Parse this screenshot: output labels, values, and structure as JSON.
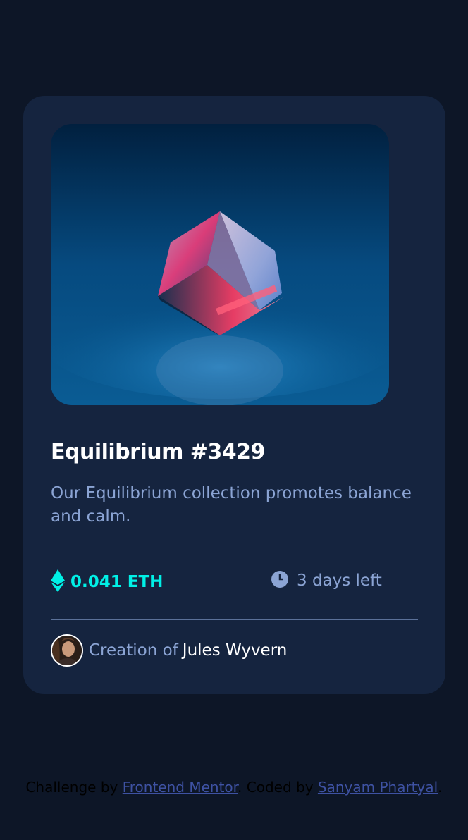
{
  "card": {
    "image_alt": "Equilibrium",
    "title": "Equilibrium #3429",
    "description": "Our Equilibrium collection promotes balance and calm.",
    "price": "0.041 ETH",
    "time_left": "3 days left",
    "creation_prefix": "Creation of",
    "creator_name": "Jules Wyvern",
    "icons": {
      "price": "ethereum-icon",
      "time": "clock-icon"
    }
  },
  "footer": {
    "prefix": "Challenge by",
    "link1": "Frontend Mentor",
    "middle": ". Coded by",
    "link2": "Sanyam Phartyal",
    "suffix": "."
  },
  "colors": {
    "page_bg": "#0d1627",
    "card_bg": "#15243f",
    "accent": "#00f0e6",
    "muted": "#8ba4d4",
    "link": "#3e52a3"
  }
}
